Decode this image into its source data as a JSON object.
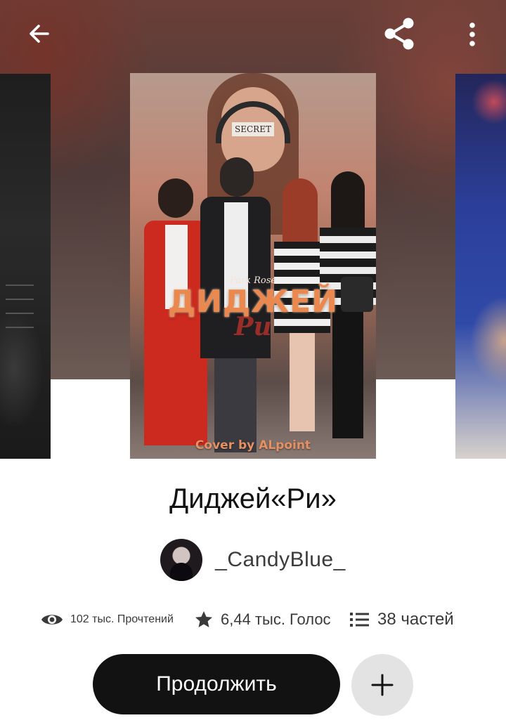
{
  "colors": {
    "primary_button": "#121212",
    "secondary_button": "#e3e3e3",
    "text": "#121212",
    "muted_text": "#3a3a3a",
    "header_blur": "#5a3f3a"
  },
  "top_bar": {
    "back_icon": "arrow-left-icon",
    "share_icon": "share-icon",
    "more_icon": "more-vertical-icon"
  },
  "cover": {
    "band_text": "SECRET",
    "subtitle": "Park Rose",
    "title": "ДИДЖЕЙ",
    "script": "Ри",
    "credit": "Cover by ALpoint"
  },
  "story": {
    "title": "Диджей«Ри»",
    "author": "_CandyBlue_"
  },
  "stats": {
    "reads": "102 тыс. Прочтений",
    "votes": "6,44 тыс. Голос",
    "parts": "38 частей",
    "reads_icon": "eye-icon",
    "votes_icon": "star-icon",
    "parts_icon": "list-icon"
  },
  "actions": {
    "continue_label": "Продолжить",
    "add_icon": "plus-icon"
  }
}
